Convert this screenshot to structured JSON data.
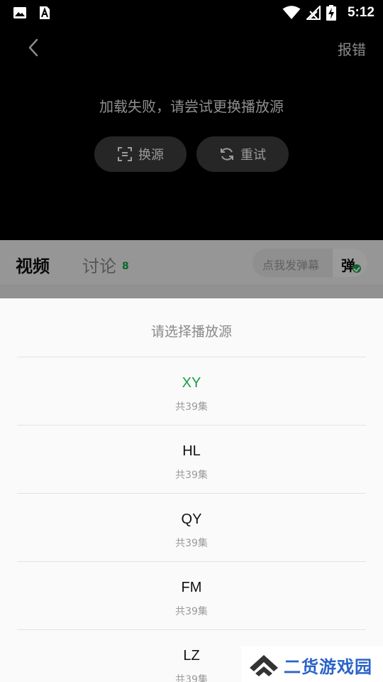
{
  "status_bar": {
    "time": "5:12",
    "left_icons": [
      "image-icon",
      "a-font-icon"
    ],
    "right_icons": [
      "wifi-icon",
      "no-signal-icon",
      "battery-charging-icon"
    ]
  },
  "player": {
    "report_label": "报错",
    "error_message": "加载失败，请尝试更换播放源",
    "switch_source_label": "换源",
    "retry_label": "重试"
  },
  "tabs": {
    "video_label": "视频",
    "discuss_label": "讨论",
    "discuss_count": "8",
    "danmu_placeholder": "点我发弹幕",
    "danmu_toggle_label": "弹"
  },
  "sheet": {
    "title": "请选择播放源",
    "sources": [
      {
        "name": "XY",
        "count": "共39集",
        "active": true
      },
      {
        "name": "HL",
        "count": "共39集",
        "active": false
      },
      {
        "name": "QY",
        "count": "共39集",
        "active": false
      },
      {
        "name": "FM",
        "count": "共39集",
        "active": false
      },
      {
        "name": "LZ",
        "count": "共39集",
        "active": false
      }
    ]
  },
  "watermark": {
    "text": "二货游戏园"
  },
  "colors": {
    "accent_green": "#1a9c46",
    "watermark_blue": "#2b63c9"
  }
}
